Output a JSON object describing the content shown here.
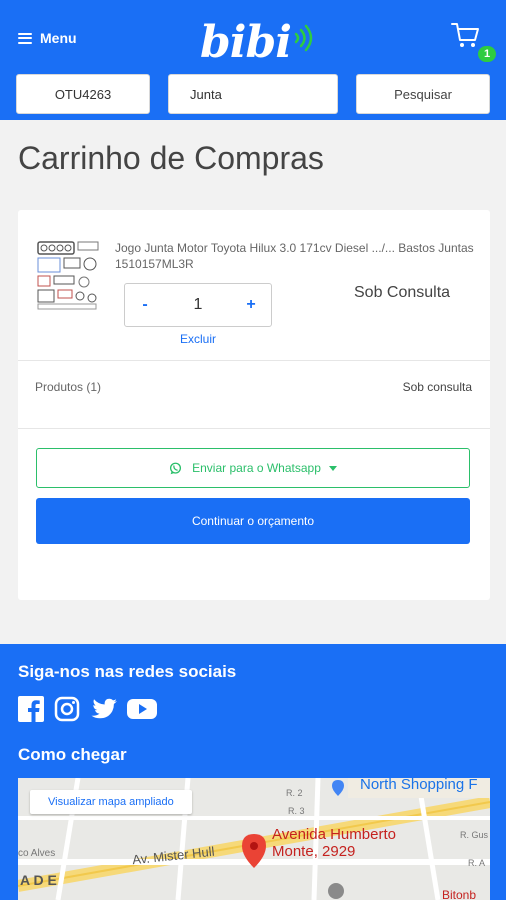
{
  "header": {
    "menu_label": "Menu",
    "logo_text": "bibi",
    "cart_count": "1",
    "plate_value": "OTU4263",
    "part_value": "Junta",
    "search_label": "Pesquisar"
  },
  "page_title": "Carrinho de Compras",
  "cart": {
    "item": {
      "name": "Jogo Junta Motor Toyota Hilux 3.0 171cv Diesel .../... Bastos Juntas 1510157ML3R",
      "quantity": "1",
      "minus_label": "-",
      "plus_label": "+",
      "remove_label": "Excluir",
      "price": "Sob Consulta"
    },
    "subtotal_label": "Produtos (1)",
    "subtotal_value": "Sob consulta",
    "whatsapp_label": "Enviar para o Whatsapp",
    "continue_label": "Continuar o orçamento"
  },
  "footer": {
    "social_title": "Siga-nos nas redes sociais",
    "directions_title": "Como chegar",
    "map": {
      "link_label": "Visualizar mapa ampliado",
      "place_line1": "Avenida Humberto",
      "place_line2": "Monte, 2929",
      "poi_label": "North Shopping F",
      "street_label": "Av. Mister Hull",
      "street2": "co Alves",
      "area_label": "A D E",
      "r2": "R. 2",
      "r3": "R. 3",
      "rgus": "R. Gus",
      "ra": "R. A",
      "bitonb": "Bitonb"
    }
  },
  "colors": {
    "primary": "#1a6ff5",
    "whatsapp": "#2bbf6a",
    "badge": "#2ecc40",
    "map_pin": "#ea4335"
  }
}
